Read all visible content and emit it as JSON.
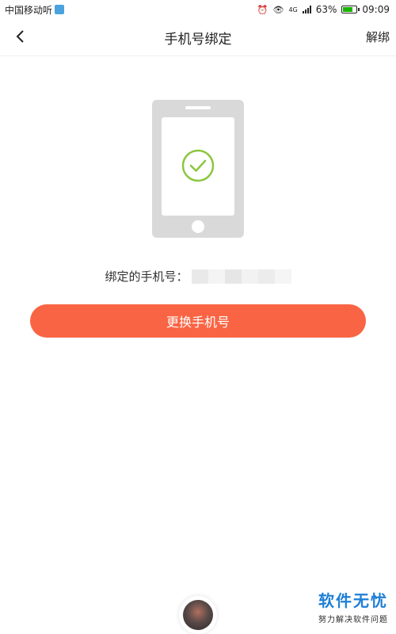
{
  "status_bar": {
    "carrier": "中国移动听",
    "network": "4G",
    "battery": "63%",
    "battery_level": 0.63,
    "time": "09:09",
    "icons": [
      "alarm-icon",
      "eye-icon",
      "signal-icon",
      "battery-icon"
    ]
  },
  "nav": {
    "back_icon": "chevron-left-icon",
    "title": "手机号绑定",
    "action": "解绑"
  },
  "illustration": {
    "icon": "phone-check-icon",
    "check_color": "#8cc63f",
    "phone_color": "#d9d9d9"
  },
  "binding": {
    "label": "绑定的手机号：",
    "masked_segments": [
      "#e9e9e9",
      "#f4f4f4",
      "#e6e6e6",
      "#f2f2f2",
      "#ececec",
      "#f5f5f5"
    ]
  },
  "button": {
    "change_label": "更换手机号",
    "color": "#f96544"
  },
  "watermark": {
    "title": "软件无忧",
    "subtitle": "努力解决软件问题",
    "color": "#1e7fd6"
  }
}
